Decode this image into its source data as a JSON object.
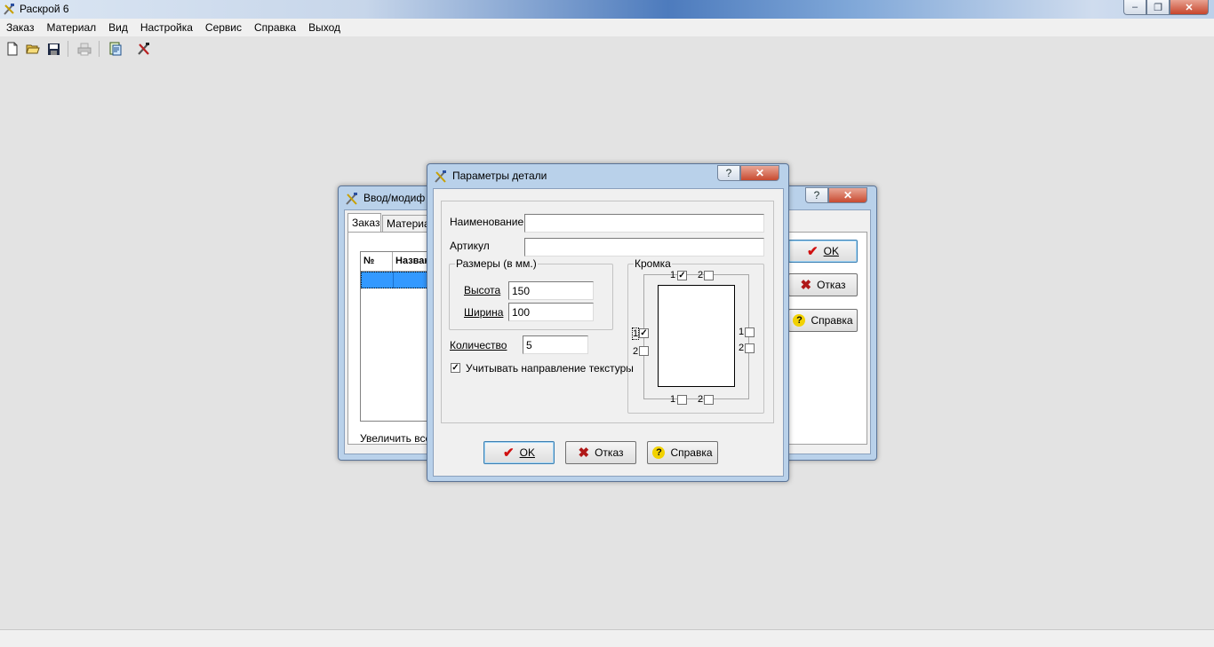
{
  "app": {
    "title": "Раскрой 6",
    "menu": [
      "Заказ",
      "Материал",
      "Вид",
      "Настройка",
      "Сервис",
      "Справка",
      "Выход"
    ],
    "toolbar": [
      "new-file-icon",
      "open-folder-icon",
      "save-icon",
      "print-icon",
      "order-report-icon",
      "cutting-tools-icon"
    ]
  },
  "back_dialog": {
    "title": "Ввод/модиф",
    "tabs": [
      "Заказ",
      "Материа"
    ],
    "table_headers": [
      "№",
      "Назван"
    ],
    "bottom_text": "Увеличить все",
    "ok_label": "OK",
    "cancel_label": "Отказ",
    "help_label": "Справка"
  },
  "detail_dialog": {
    "title": "Параметры детали",
    "name_label": "Наименование",
    "name_value": "",
    "article_label": "Артикул",
    "article_value": "",
    "sizes_group": "Размеры (в мм.)",
    "height_label": "Высота",
    "height_value": "150",
    "width_label": "Ширина",
    "width_value": "100",
    "quantity_label": "Количество",
    "quantity_value": "5",
    "texture_label": "Учитывать направление текстуры",
    "texture_checked": true,
    "edge_group": "Кромка",
    "edge": {
      "top": {
        "one": "1",
        "two": "2",
        "one_checked": true,
        "two_checked": false
      },
      "left": {
        "one": "1",
        "two": "2",
        "one_checked": true,
        "two_checked": false
      },
      "right": {
        "one": "1",
        "two": "2",
        "one_checked": false,
        "two_checked": false
      },
      "bottom": {
        "one": "1",
        "two": "2",
        "one_checked": false,
        "two_checked": false
      }
    },
    "ok_label": "OK",
    "cancel_label": "Отказ",
    "help_label": "Справка"
  },
  "colors": {
    "desktop": "#e3e3e3",
    "dialog_frame": "#b9d1ea",
    "selection": "#3399ff",
    "ok_check": "#d01010",
    "cancel_x": "#b01818",
    "help_q": "#e8c000"
  }
}
